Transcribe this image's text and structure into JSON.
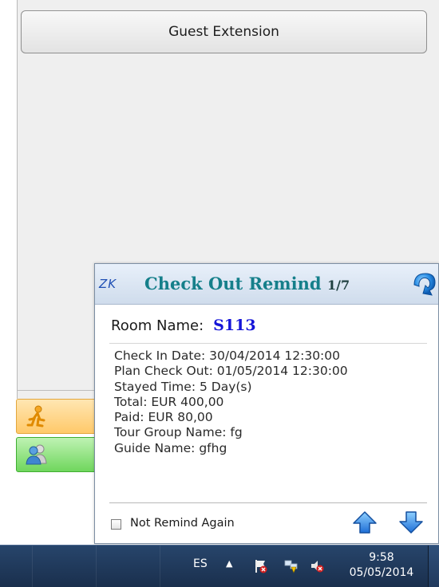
{
  "app": {
    "guest_extension_label": "Guest Extension"
  },
  "popup": {
    "logo": "ZK",
    "title": "Check Out Remind",
    "counter": "1/7",
    "room_label": "Room Name:",
    "room_value": "S113",
    "details": [
      "Check In Date: 30/04/2014 12:30:00",
      "Plan Check Out: 01/05/2014 12:30:00",
      "Stayed Time: 5 Day(s)",
      "Total: EUR 400,00",
      "Paid: EUR 80,00",
      "Tour Group Name: fg",
      "Guide Name: gfhg"
    ],
    "not_remind_label": "Not Remind Again",
    "not_remind_checked": false
  },
  "taskbar": {
    "language": "ES",
    "time": "9:58",
    "date": "05/05/2014"
  },
  "colors": {
    "title": "#157f8a",
    "room_value": "#1414d8",
    "taskbar": "#1f3a5e"
  },
  "icons": [
    "zk-logo",
    "popup-close-icon",
    "arrow-up-icon",
    "arrow-down-icon",
    "guest-icon",
    "user-group-icon",
    "flag-icon",
    "network-icon",
    "volume-icon"
  ]
}
